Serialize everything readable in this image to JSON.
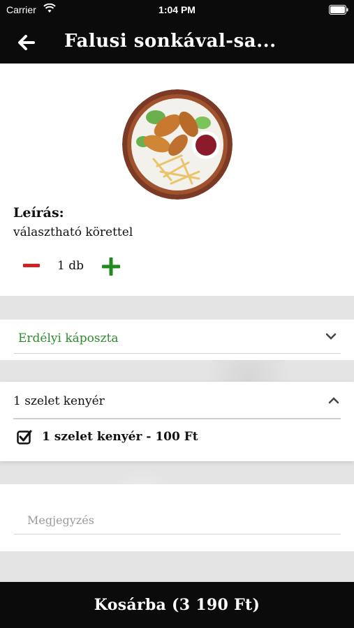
{
  "status_bar": {
    "carrier": "Carrier",
    "time": "1:04 PM"
  },
  "header": {
    "title": "Falusi sonkával-sa..."
  },
  "product": {
    "description_label": "Leírás:",
    "description": "választható körettel",
    "quantity": "1 db"
  },
  "garnish": {
    "selected": "Erdélyi káposzta"
  },
  "extras": {
    "title": "1 szelet kenyér",
    "options": [
      {
        "label": "1 szelet kenyér - 100 Ft",
        "checked": true
      }
    ]
  },
  "note": {
    "placeholder": "Megjegyzés",
    "value": ""
  },
  "cart_button": {
    "label": "Kosárba (3 190 Ft)"
  },
  "colors": {
    "header_bg": "#0b0b0b",
    "accent_green": "#2e8b2e",
    "minus_red": "#d42020",
    "plus_green": "#1f8a1f"
  },
  "icons": [
    "wifi-icon",
    "battery-icon",
    "back-arrow-icon",
    "minus-icon",
    "plus-icon",
    "chevron-down-icon",
    "chevron-up-icon",
    "checkbox-checked-icon"
  ]
}
